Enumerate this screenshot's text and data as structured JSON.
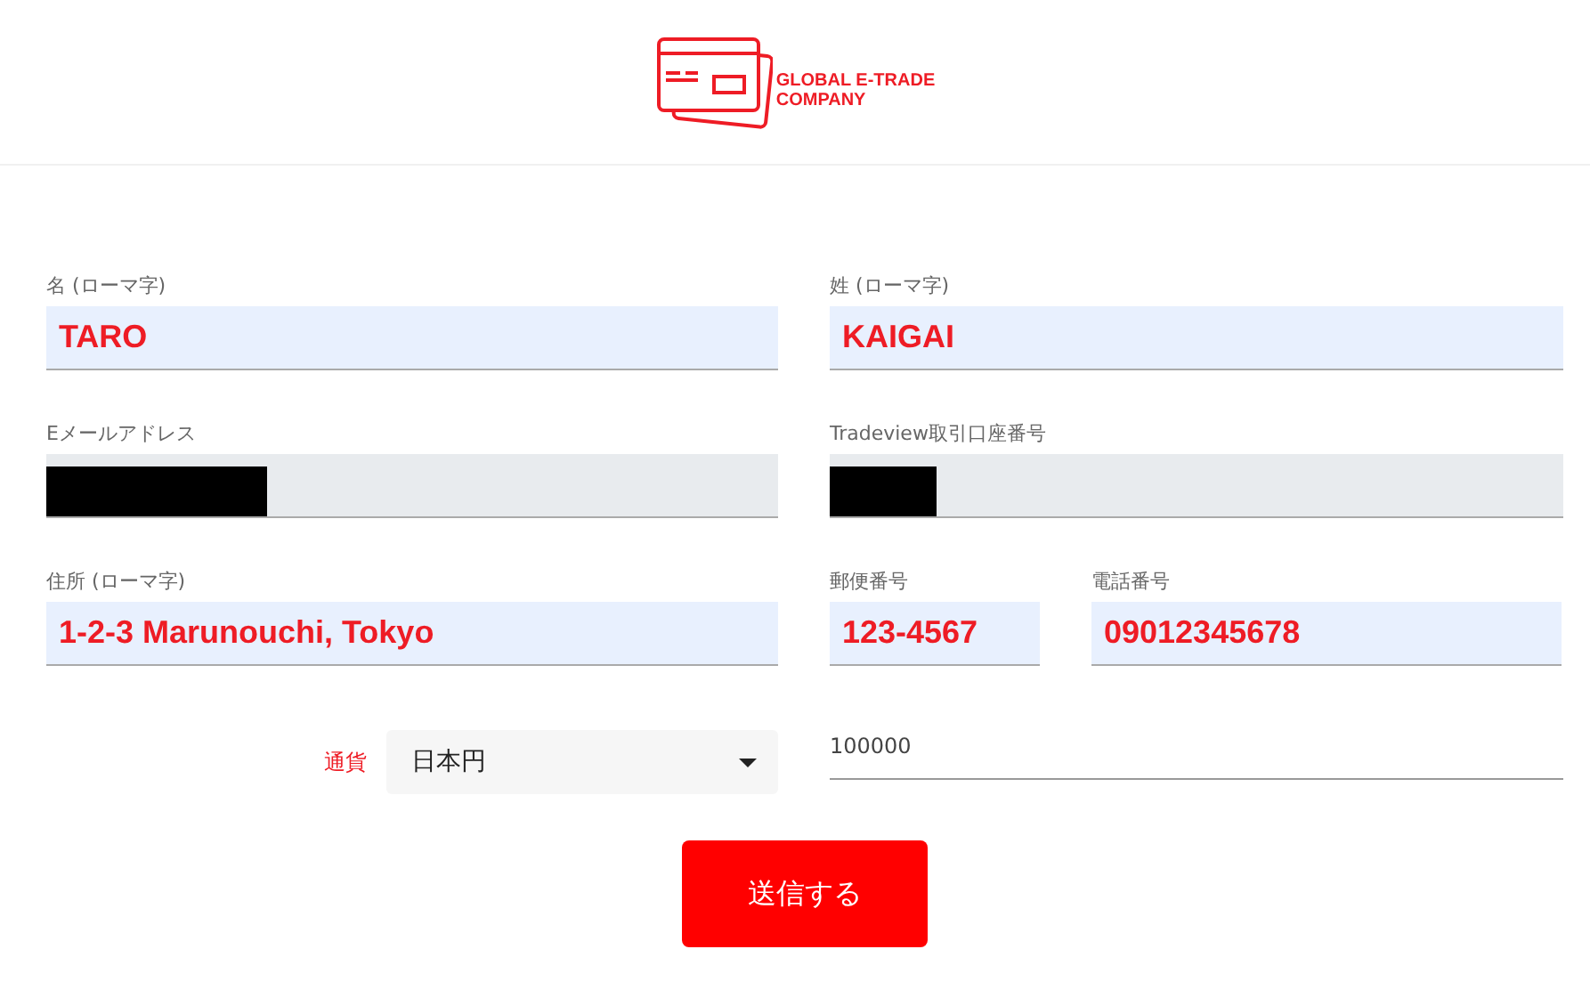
{
  "logo": {
    "line_1": "GLOBAL E-TRADE",
    "line_2": "COMPANY"
  },
  "rows": [
    {
      "fields": [
        {
          "kind": "text",
          "label": "名 (ローマ字)",
          "value": "TARO",
          "disabled": false
        },
        {
          "kind": "text",
          "label": "姓 (ローマ字)",
          "value": "KAIGAI",
          "disabled": false
        }
      ]
    },
    {
      "fields": [
        {
          "kind": "redacted",
          "label": "Eメールアドレス",
          "disabled": true
        },
        {
          "kind": "redacted",
          "label": "Tradeview取引口座番号",
          "disabled": true
        }
      ]
    },
    {
      "fields": [
        {
          "kind": "text",
          "label": "住所 (ローマ字)",
          "value": "1-2-3 Marunouchi, Tokyo",
          "disabled": false
        },
        {
          "kind": "text",
          "label": "郵便番号",
          "value": "123-4567",
          "disabled": false
        },
        {
          "kind": "text",
          "label": "電話番号",
          "value": "09012345678",
          "disabled": false
        }
      ]
    }
  ],
  "currency": {
    "label": "通貨",
    "value": "日本円"
  },
  "amount": {
    "value": "100000"
  },
  "submit": "送信する"
}
